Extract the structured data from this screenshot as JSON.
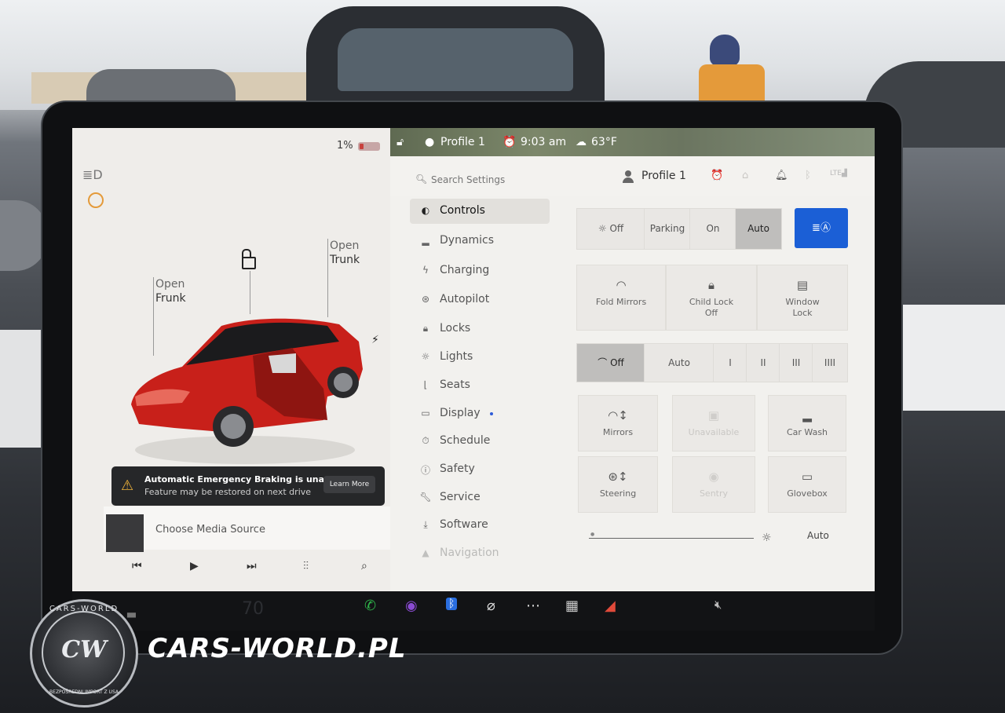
{
  "status_bar": {
    "battery_percent": "1%",
    "profile": "Profile 1",
    "time": "9:03 am",
    "temperature": "63°F"
  },
  "vehicle": {
    "frunk": {
      "line1": "Open",
      "line2": "Frunk"
    },
    "trunk": {
      "line1": "Open",
      "line2": "Trunk"
    }
  },
  "alert": {
    "title": "Automatic Emergency Braking is unav...",
    "subtitle": "Feature may be restored on next drive",
    "button": "Learn More"
  },
  "media": {
    "source_label": "Choose Media Source"
  },
  "settings": {
    "search_placeholder": "Search Settings",
    "profile_name": "Profile 1",
    "nav": [
      {
        "label": "Controls",
        "icon": "toggle-icon"
      },
      {
        "label": "Dynamics",
        "icon": "car-icon"
      },
      {
        "label": "Charging",
        "icon": "bolt-icon"
      },
      {
        "label": "Autopilot",
        "icon": "steering-wheel-icon"
      },
      {
        "label": "Locks",
        "icon": "lock-icon"
      },
      {
        "label": "Lights",
        "icon": "sun-icon"
      },
      {
        "label": "Seats",
        "icon": "seat-icon"
      },
      {
        "label": "Display",
        "icon": "display-icon"
      },
      {
        "label": "Schedule",
        "icon": "clock-icon"
      },
      {
        "label": "Safety",
        "icon": "info-icon"
      },
      {
        "label": "Service",
        "icon": "wrench-icon"
      },
      {
        "label": "Software",
        "icon": "download-icon"
      },
      {
        "label": "Navigation",
        "icon": "navigation-icon"
      }
    ],
    "selected_nav": "Controls"
  },
  "controls": {
    "headlights": {
      "options": [
        "Off",
        "Parking",
        "On",
        "Auto"
      ],
      "selected": "Auto"
    },
    "tiles_row1": [
      {
        "label": "Fold Mirrors",
        "sub": ""
      },
      {
        "label": "Child Lock",
        "sub": "Off"
      },
      {
        "label": "Window",
        "sub": "Lock"
      }
    ],
    "wipers": {
      "options": [
        "Off",
        "Auto",
        "I",
        "II",
        "III",
        "IIII"
      ],
      "selected": "Off"
    },
    "tiles_row2": [
      {
        "label": "Mirrors"
      },
      {
        "label": "Unavailable"
      },
      {
        "label": "Car Wash"
      }
    ],
    "tiles_row3": [
      {
        "label": "Steering"
      },
      {
        "label": "Sentry"
      },
      {
        "label": "Glovebox"
      }
    ],
    "brightness_auto": "Auto"
  },
  "dock": {
    "speed": "70"
  },
  "watermark": {
    "brand": "CARS-WORLD.PL",
    "logo_text": "CW",
    "logo_top": "CARS-WORLD",
    "logo_side": "BEZPOŚREDNI IMPORT Z USA"
  },
  "colors": {
    "accent_blue": "#1b5fd6",
    "car_red": "#c8201a",
    "alert_bg": "#262729",
    "warning": "#f0b33a"
  }
}
